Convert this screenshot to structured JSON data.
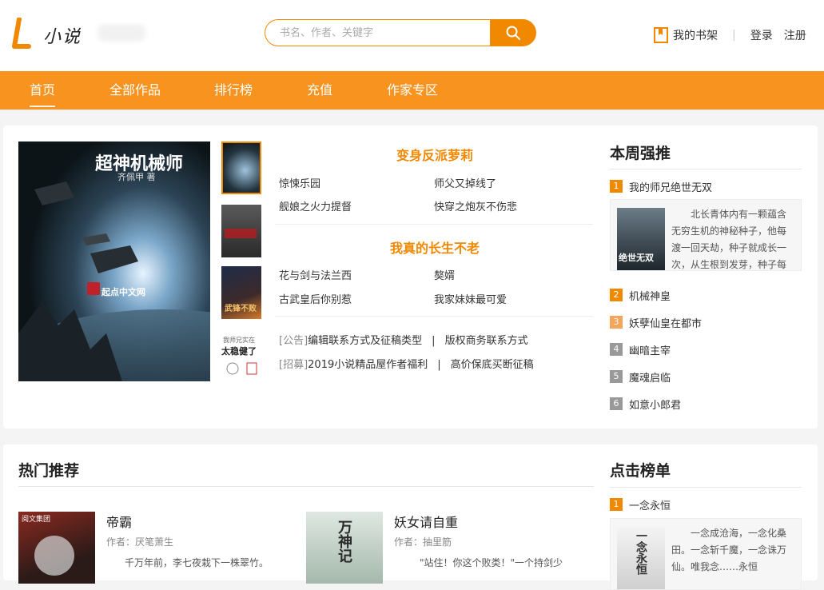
{
  "header": {
    "logo_text": "小说",
    "search_placeholder": "书名、作者、关键字",
    "bookshelf": "我的书架",
    "login": "登录",
    "register": "注册"
  },
  "nav": [
    "首页",
    "全部作品",
    "排行榜",
    "充值",
    "作家专区"
  ],
  "featured": {
    "main_cover_title": "超神机械师",
    "main_cover_author": "齐佩甲 著",
    "main_cover_brand": "起点中文网",
    "thumb3_title": "武锋不败",
    "thumb4_title": "太稳健了",
    "thumb4_small": "我师兄实在",
    "group1_title": "变身反派萝莉",
    "group1_links": [
      "惊悚乐园",
      "师父又掉线了",
      "舰娘之火力提督",
      "快穿之炮灰不伤悲"
    ],
    "group2_title": "我真的长生不老",
    "group2_links": [
      "花与剑与法兰西",
      "獒婿",
      "古武皇后你别惹",
      "我家妹妹最可爱"
    ],
    "notices": [
      {
        "tag": "[公告]",
        "text1": "编辑联系方式及征稿类型",
        "text2": "版权商务联系方式"
      },
      {
        "tag": "[招募]",
        "text1": "2019小说精品屋作者福利",
        "text2": "高价保底买断征稿"
      }
    ]
  },
  "weekly": {
    "title": "本周强推",
    "top": {
      "num": "1",
      "name": "我的师兄绝世无双",
      "desc": "北长青体内有一颗蕴含无穷生机的神秘种子，他每渡一回天劫，种子就成长一次，从生根到发芽，种子每",
      "cover_text": "绝世无双"
    },
    "items": [
      {
        "num": "2",
        "name": "机械神皇",
        "color": "#f08800"
      },
      {
        "num": "3",
        "name": "妖孽仙皇在都市",
        "color": "#f5a45c"
      },
      {
        "num": "4",
        "name": "幽暗主宰",
        "color": "#999999"
      },
      {
        "num": "5",
        "name": "魔魂启临",
        "color": "#999999"
      },
      {
        "num": "6",
        "name": "如意小郎君",
        "color": "#999999"
      }
    ]
  },
  "hot": {
    "title": "热门推荐",
    "books": [
      {
        "title": "帝霸",
        "author": "作者：厌笔萧生",
        "desc": "千万年前，李七夜栽下一株翠竹。",
        "cover_tag": "阅文集团"
      },
      {
        "title": "妖女请自重",
        "author": "作者：抽里筋",
        "desc": "\"站住！你这个败类！\"一个持剑少",
        "cover_text": "万神记"
      }
    ]
  },
  "click_rank": {
    "title": "点击榜单",
    "top": {
      "num": "1",
      "name": "一念永恒",
      "desc": "一念成沧海，一念化桑田。一念斩千魔，一念诛万仙。唯我念……永恒",
      "cover_text": "一念永恒"
    }
  },
  "colors": {
    "accent": "#f08800",
    "nav": "#f7931e"
  }
}
